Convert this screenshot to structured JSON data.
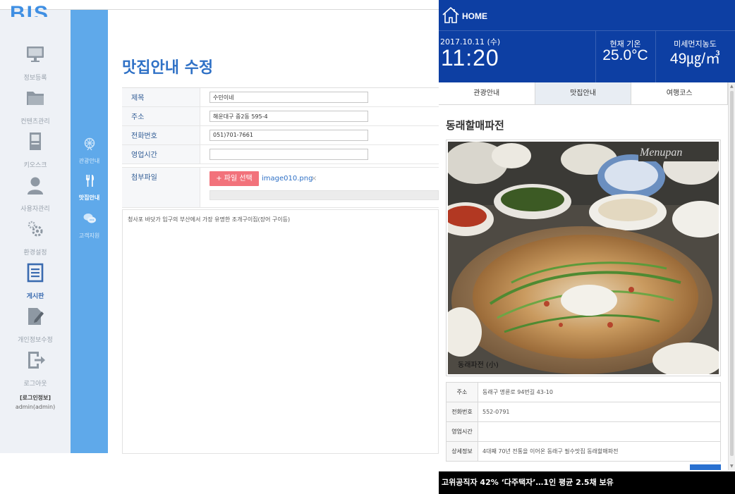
{
  "app": {
    "logo": "BIS"
  },
  "sidebar": {
    "items": [
      {
        "label": "정보등록",
        "icon": "monitor-icon"
      },
      {
        "label": "컨텐츠관리",
        "icon": "folder-icon"
      },
      {
        "label": "키오스크",
        "icon": "kiosk-icon"
      },
      {
        "label": "사용자관리",
        "icon": "user-icon"
      },
      {
        "label": "환경설정",
        "icon": "gear-icon"
      },
      {
        "label": "게시판",
        "icon": "board-icon"
      },
      {
        "label": "개인정보수정",
        "icon": "edit-icon"
      },
      {
        "label": "로그아웃",
        "icon": "logout-icon"
      }
    ],
    "active": "게시판",
    "login_title": "[로그인정보]",
    "login_user": "admin(admin)"
  },
  "subbar": {
    "items": [
      {
        "label": "관광안내",
        "icon": "ferris-wheel-icon"
      },
      {
        "label": "맛집안내",
        "icon": "fork-knife-icon"
      },
      {
        "label": "고객지원",
        "icon": "chat-bubble-icon"
      }
    ],
    "active": "맛집안내"
  },
  "main": {
    "title": "맛집안내 수정",
    "fields": {
      "title_label": "제목",
      "title_value": "수민이네",
      "address_label": "주소",
      "address_value": "해운대구 중2동 595-4",
      "phone_label": "전화번호",
      "phone_value": "051)701-7661",
      "hours_label": "영업시간",
      "hours_value": "",
      "attach_label": "첨부파일",
      "attach_button": "+ 파일 선택",
      "attach_filename": "image010.png",
      "attach_remove": "×"
    },
    "editor_text": "청사포 바닷가 입구의 부산에서 가장 유명한 조개구이집(장어 구이등)"
  },
  "kiosk": {
    "home_label": "HOME",
    "date": "2017.10.11 (수)",
    "time": "11:20",
    "temp_label": "현재 기온",
    "temp_value": "25.0°C",
    "dust_label": "미세먼지농도",
    "dust_value": "49㎍/㎥",
    "tabs": [
      "관광안내",
      "맛집안내",
      "여행코스"
    ],
    "active_tab": "맛집안내",
    "place_name": "동래할매파전",
    "photo_watermark": "Menupan",
    "photo_caption": "동래파전 (小)",
    "info": {
      "address_label": "주소",
      "address_value": "동래구 명륜로 94번길 43-10",
      "phone_label": "전화번호",
      "phone_value": "552-0791",
      "hours_label": "영업시간",
      "hours_value": "",
      "detail_label": "상세정보",
      "detail_value": "4대째 70년 전통을 이어온 동래구 필수맛집 동래할매파전"
    },
    "ticker": "고위공직자 42% ‘다주택자’…1인 평균 2.5채 보유"
  },
  "colors": {
    "kiosk_header": "#0d3fa3",
    "subbar": "#5fa9ea",
    "title": "#2f71c6",
    "file_button": "#f2727b"
  }
}
